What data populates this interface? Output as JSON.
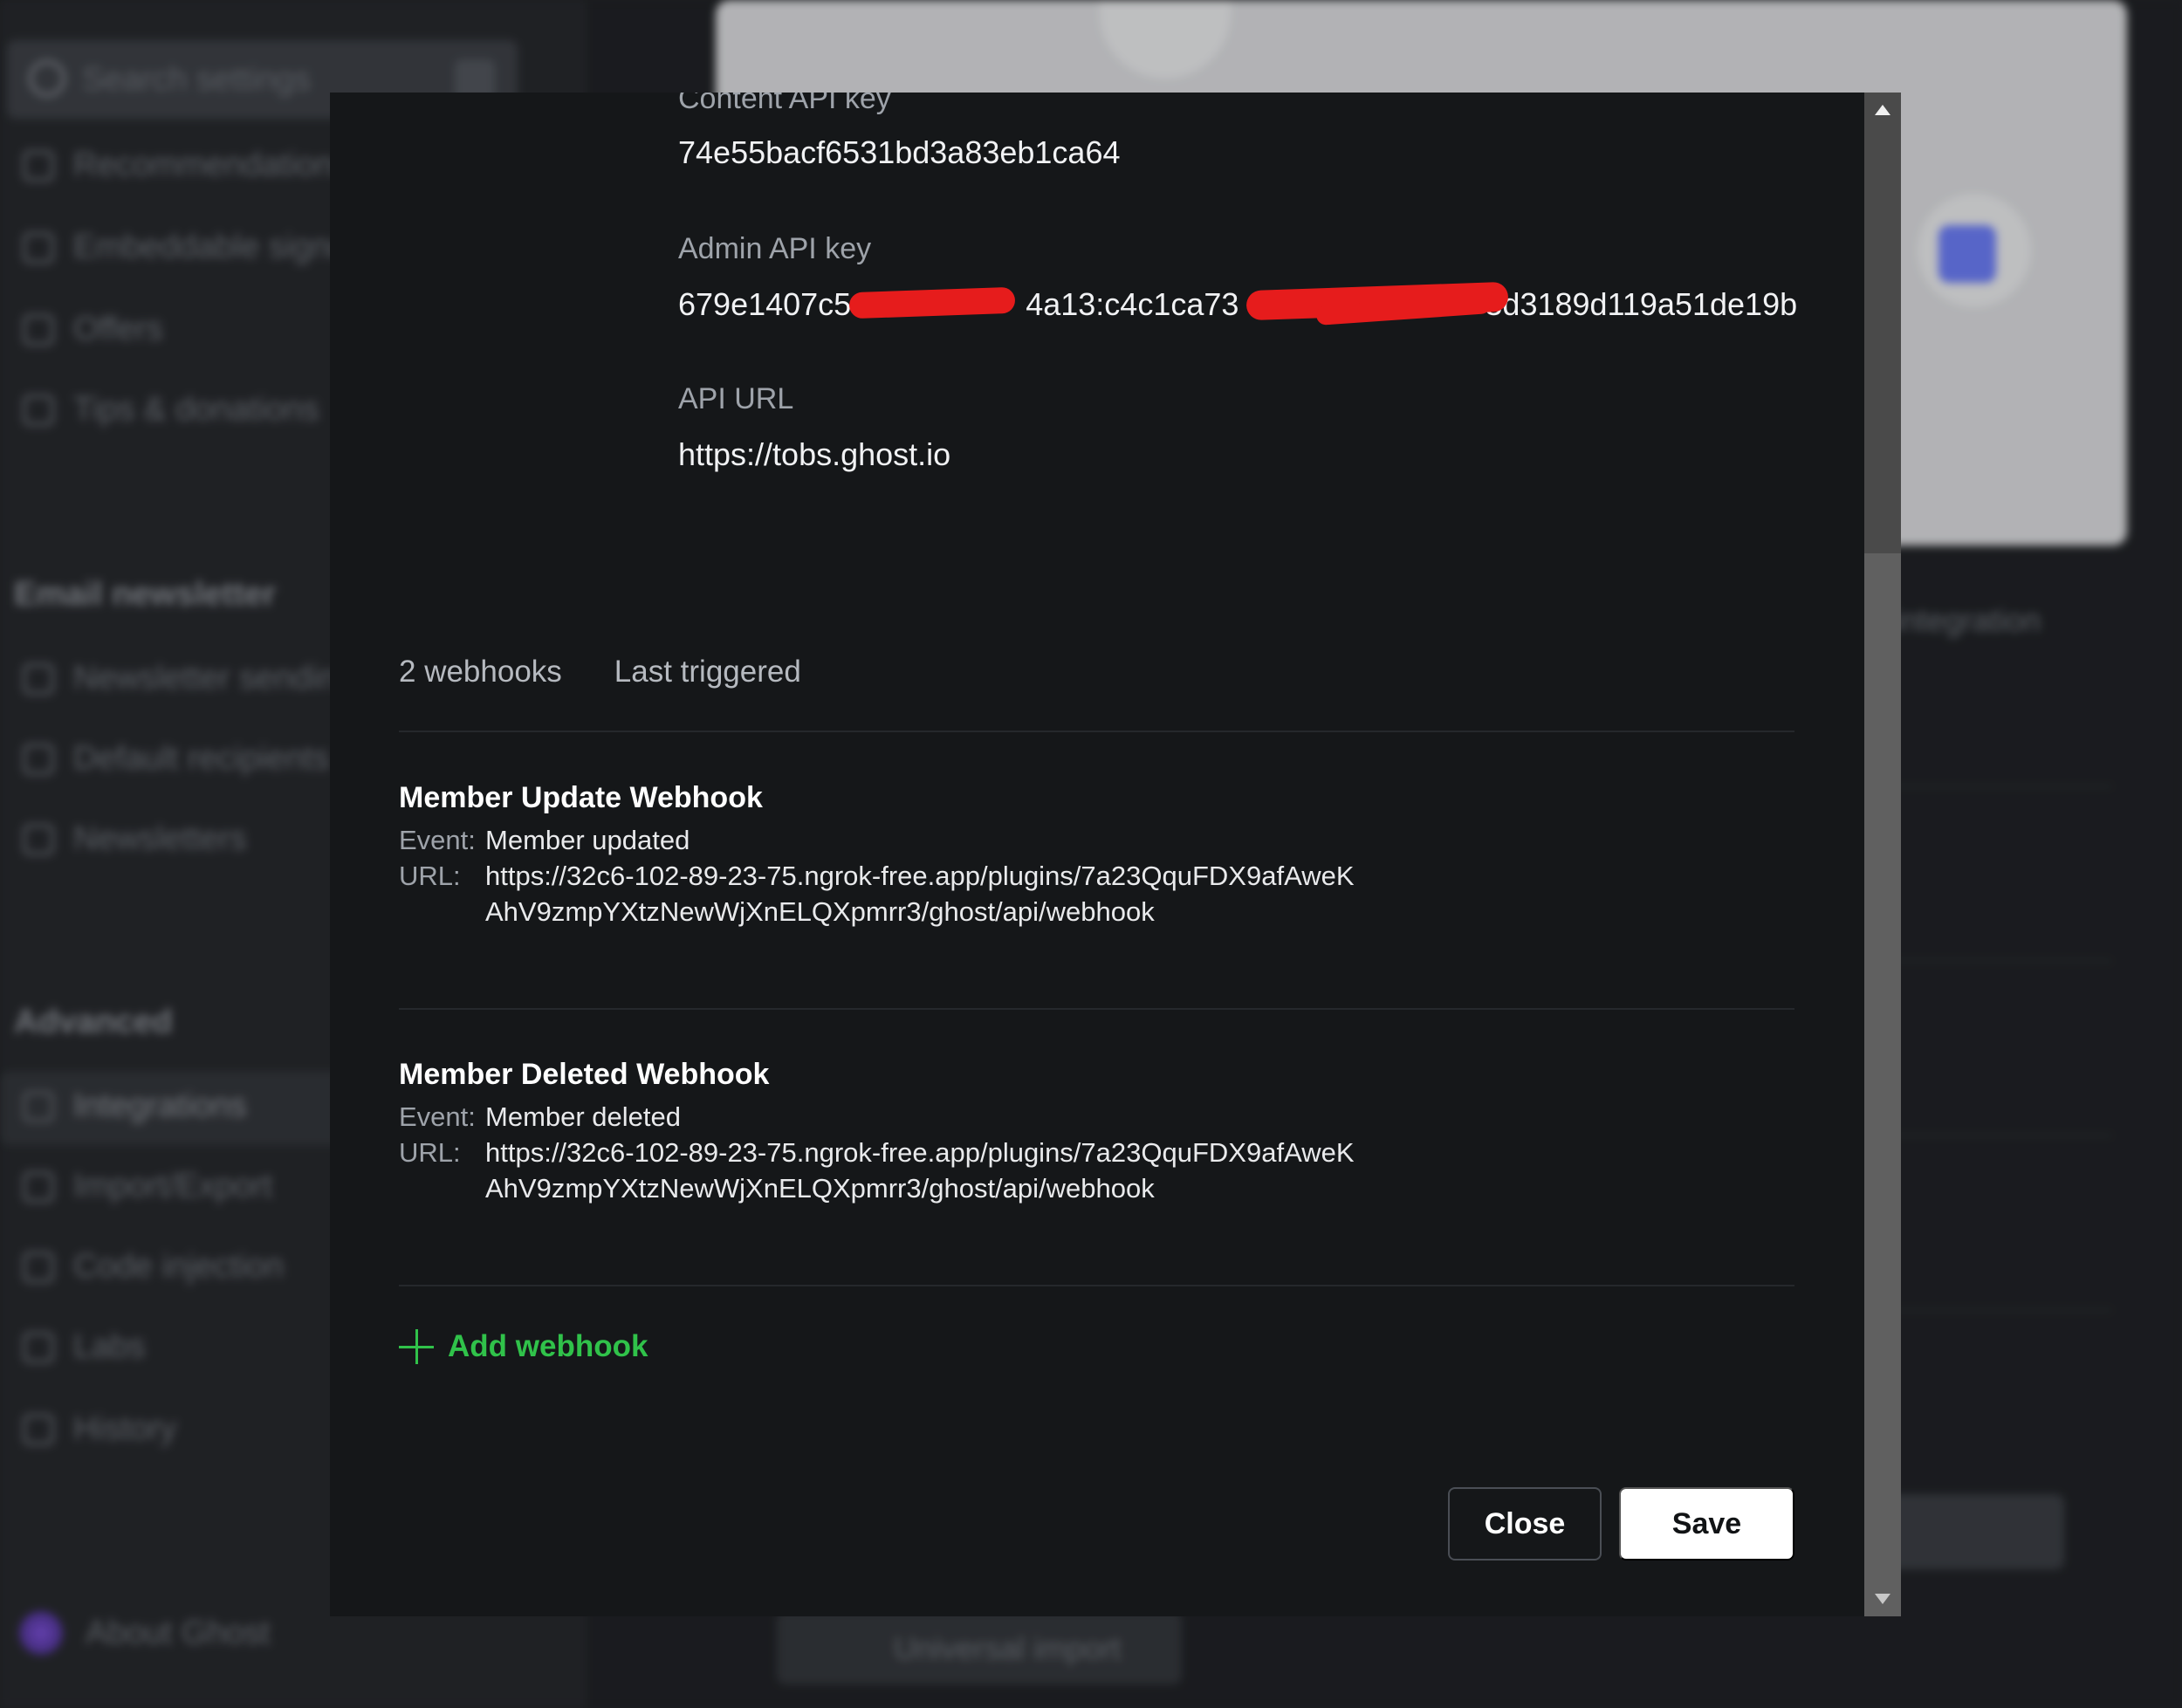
{
  "background": {
    "search_placeholder": "Search settings",
    "sidebar_items_top": [
      "Recommendations",
      "Embeddable signup",
      "Offers",
      "Tips & donations"
    ],
    "email_heading": "Email newsletter",
    "email_items": [
      "Newsletter sending",
      "Default recipients",
      "Newsletters"
    ],
    "advanced_heading": "Advanced",
    "advanced_items": [
      "Integrations",
      "Import/Export",
      "Code injection",
      "Labs",
      "History"
    ],
    "about": "About Ghost",
    "right_label": "integration",
    "bottom_button": "Universal import"
  },
  "api": {
    "content_label": "Content API key",
    "content_value": "74e55bacf6531bd3a83eb1ca64",
    "admin_label": "Admin API key",
    "admin_value_visible_1": "679e1407c5",
    "admin_value_visible_2": "4a13:c4c1ca73",
    "admin_value_visible_3": "3d3189d119a51de19b",
    "url_label": "API URL",
    "url_value": "https://tobs.ghost.io"
  },
  "webhooks": {
    "count_label": "2 webhooks",
    "last_triggered_label": "Last triggered",
    "event_key": "Event:",
    "url_key": "URL:",
    "items": [
      {
        "name": "Member Update Webhook",
        "event": "Member updated",
        "url": "https://32c6-102-89-23-75.ngrok-free.app/plugins/7a23QquFDX9afAweKAhV9zmpYXtzNewWjXnELQXpmrr3/ghost/api/webhook"
      },
      {
        "name": "Member Deleted Webhook",
        "event": "Member deleted",
        "url": "https://32c6-102-89-23-75.ngrok-free.app/plugins/7a23QquFDX9afAweKAhV9zmpYXtzNewWjXnELQXpmrr3/ghost/api/webhook"
      }
    ],
    "add_label": "Add webhook"
  },
  "buttons": {
    "close": "Close",
    "save": "Save"
  },
  "colors": {
    "accent_green": "#30c24a",
    "modal_bg": "#151719",
    "redaction": "#e61c1c"
  }
}
